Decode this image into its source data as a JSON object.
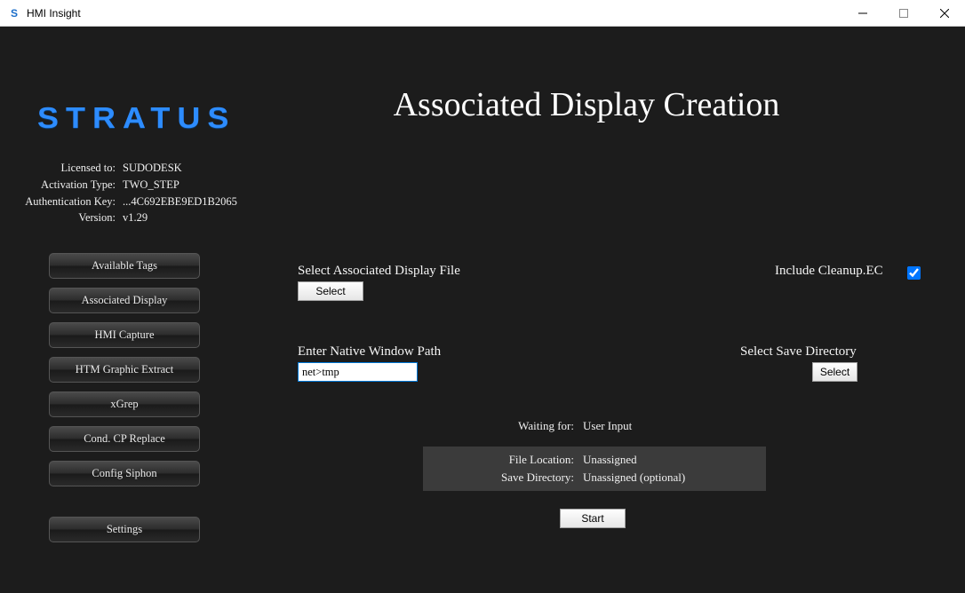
{
  "window": {
    "title": "HMI Insight"
  },
  "logo": "STRATUS",
  "license": {
    "rows": [
      {
        "label": "Licensed to:",
        "value": "SUDODESK"
      },
      {
        "label": "Activation Type:",
        "value": "TWO_STEP"
      },
      {
        "label": "Authentication Key:",
        "value": "...4C692EBE9ED1B2065"
      },
      {
        "label": "Version:",
        "value": "v1.29"
      }
    ]
  },
  "sidebar": {
    "items": [
      "Available Tags",
      "Associated Display",
      "HMI Capture",
      "HTM Graphic Extract",
      "xGrep",
      "Cond. CP Replace",
      "Config Siphon"
    ],
    "settings": "Settings"
  },
  "page": {
    "title": "Associated Display Creation",
    "select_file_label": "Select Associated Display File",
    "select_file_button": "Select",
    "include_cleanup_label": "Include Cleanup.EC",
    "include_cleanup_checked": true,
    "native_path_label": "Enter Native Window Path",
    "native_path_value": "net>tmp",
    "save_dir_label": "Select Save Directory",
    "save_dir_button": "Select",
    "waiting": {
      "label": "Waiting for:",
      "value": "User Input"
    },
    "status": [
      {
        "label": "File Location:",
        "value": "Unassigned"
      },
      {
        "label": "Save Directory:",
        "value": "Unassigned (optional)"
      }
    ],
    "start_button": "Start"
  }
}
